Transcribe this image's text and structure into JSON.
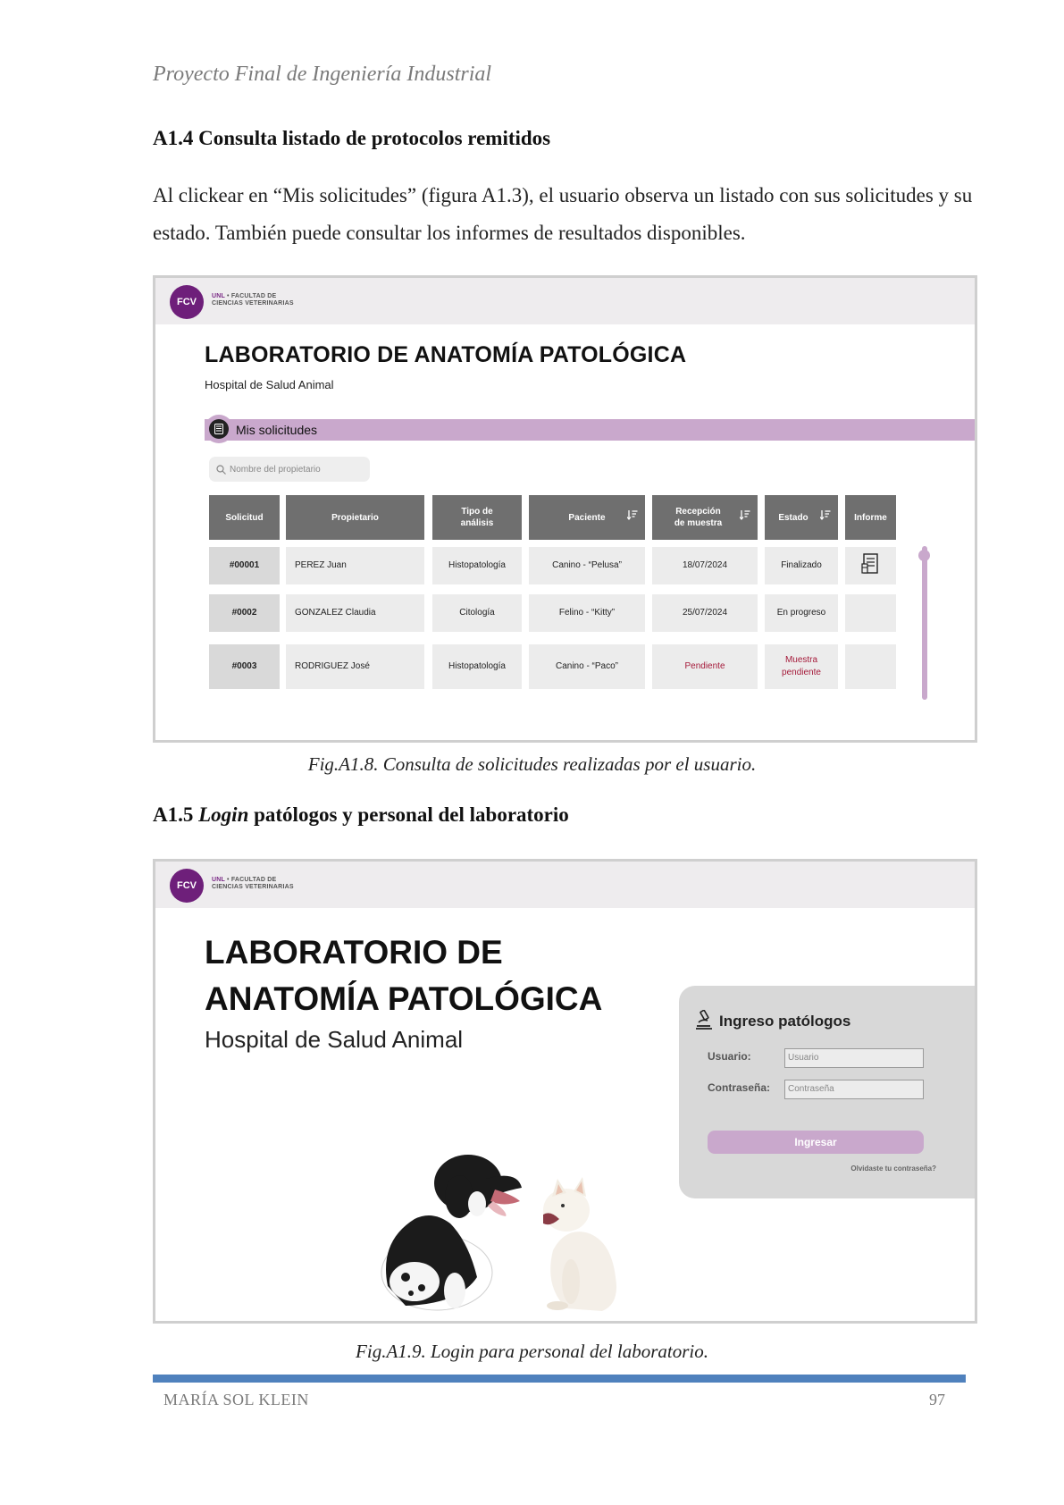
{
  "running_header": "Proyecto Final de Ingeniería Industrial",
  "section_a14": {
    "heading": "A1.4 Consulta listado de protocolos remitidos",
    "paragraph": "Al clickear en “Mis solicitudes” (figura A1.3), el usuario observa un listado con sus solicitudes y su estado. También puede consultar los informes de resultados disponibles."
  },
  "figure1": {
    "logo_badge": "FCV",
    "logo_line1_prefix": "UNL",
    "logo_line1": " • FACULTAD DE",
    "logo_line2": "CIENCIAS VETERINARIAS",
    "lab_title": "LABORATORIO DE ANATOMÍA PATOLÓGICA",
    "lab_subtitle": "Hospital de Salud Animal",
    "section_label": "Mis solicitudes",
    "search_placeholder": "Nombre del propietario",
    "columns": [
      "Solicitud",
      "Propietario",
      "Tipo de análisis",
      "Paciente",
      "Recepción de muestra",
      "Estado",
      "Informe"
    ],
    "rows": [
      {
        "id": "#00001",
        "owner": "PEREZ Juan",
        "type": "Histopatología",
        "patient": "Canino - “Pelusa”",
        "reception": "18/07/2024",
        "status": "Finalizado",
        "report_icon": "document-icon"
      },
      {
        "id": "#0002",
        "owner": "GONZALEZ Claudia",
        "type": "Citología",
        "patient": "Felino - “Kitty”",
        "reception": "25/07/2024",
        "status": "En progreso",
        "report_icon": ""
      },
      {
        "id": "#0003",
        "owner": "RODRIGUEZ José",
        "type": "Histopatología",
        "patient": "Canino - “Paco”",
        "reception": "Pendiente",
        "status": "Muestra pendiente",
        "report_icon": ""
      }
    ],
    "caption": "Fig.A1.8. Consulta de solicitudes realizadas por el usuario."
  },
  "section_a15": {
    "heading_prefix": "A1.5 ",
    "heading_italic": "Login",
    "heading_suffix": " patólogos y personal del laboratorio"
  },
  "figure2": {
    "logo_badge": "FCV",
    "logo_line1_prefix": "UNL",
    "logo_line1": " • FACULTAD DE",
    "logo_line2": "CIENCIAS VETERINARIAS",
    "title_line1": "LABORATORIO DE",
    "title_line2": "ANATOMÍA PATOLÓGICA",
    "subtitle": "Hospital de Salud Animal",
    "login_title": "Ingreso patólogos",
    "user_label": "Usuario:",
    "user_placeholder": "Usuario",
    "password_label": "Contraseña:",
    "password_placeholder": "Contraseña",
    "submit_label": "Ingresar",
    "forgot_label": "Olvidaste tu contraseña?",
    "caption": "Fig.A1.9. Login para personal del laboratorio."
  },
  "footer": {
    "author": "MARÍA SOL KLEIN",
    "page_number": "97"
  },
  "colors": {
    "brand_purple": "#6e1f7a",
    "accent_lilac": "#c9a8cc",
    "header_gray": "#6f6f6f",
    "alert_red": "#a51a3a",
    "footer_blue": "#4f81bd"
  }
}
